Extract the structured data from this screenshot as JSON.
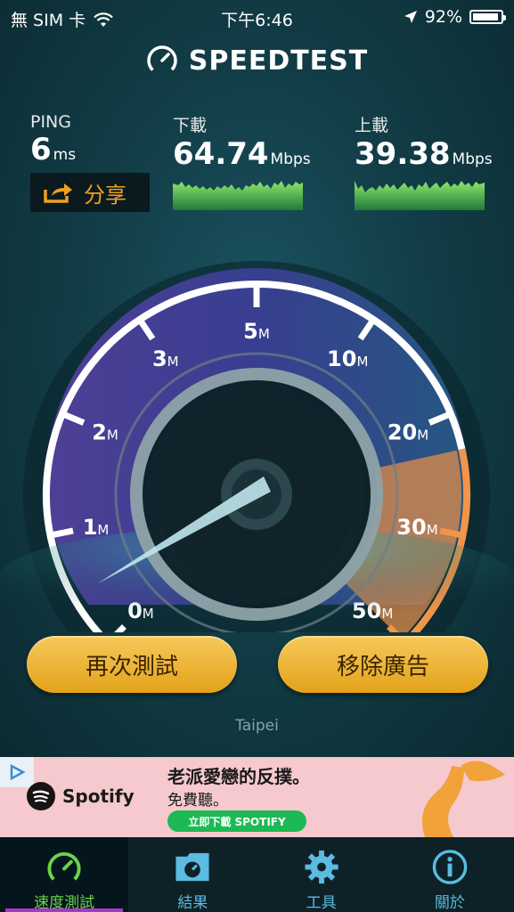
{
  "status_bar": {
    "carrier": "無 SIM 卡",
    "time": "下午6:46",
    "battery": "92%",
    "battery_level": 0.92
  },
  "header": {
    "title": "SPEEDTEST"
  },
  "stats": {
    "ping": {
      "label": "PING",
      "value": "6",
      "unit": "ms"
    },
    "download": {
      "label": "下載",
      "value": "64.74",
      "unit": "Mbps"
    },
    "upload": {
      "label": "上載",
      "value": "39.38",
      "unit": "Mbps"
    },
    "share_label": "分享"
  },
  "gauge": {
    "ticks": [
      "0",
      "1",
      "2",
      "3",
      "5",
      "10",
      "20",
      "30",
      "50"
    ],
    "unit": "M",
    "needle_value": "0"
  },
  "buttons": {
    "retest": "再次測試",
    "remove_ads": "移除廣告"
  },
  "location": "Taipei",
  "ad": {
    "brand": "Spotify",
    "headline": "老派愛戀的反撲。",
    "subline": "免費聽。",
    "cta": "立即下載 SPOTIFY"
  },
  "tabs": [
    {
      "label": "速度測試",
      "icon": "speedometer-icon",
      "active": true
    },
    {
      "label": "結果",
      "icon": "results-folder-icon",
      "active": false
    },
    {
      "label": "工具",
      "icon": "gear-icon",
      "active": false
    },
    {
      "label": "關於",
      "icon": "info-icon",
      "active": false
    }
  ],
  "colors": {
    "accent_orange": "#f0a020",
    "download_graph": "#4bd36a",
    "tab_active": "#6cd34a",
    "tab_inactive": "#5bbbe0",
    "button_gold": "#e8ad2a"
  }
}
